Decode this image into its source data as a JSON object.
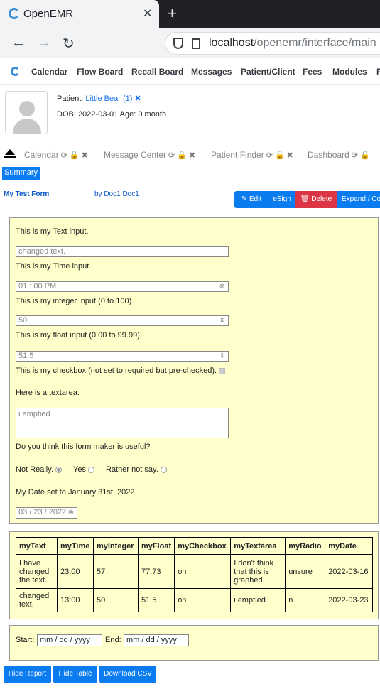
{
  "browser": {
    "tab_title": "OpenEMR",
    "tab_close": "✕",
    "new_tab": "+",
    "url_host": "localhost",
    "url_path": "/openemr/interface/main",
    "back": "←",
    "forward": "→",
    "reload": "↻"
  },
  "menu": {
    "items": [
      "Calendar",
      "Flow Board",
      "Recall Board",
      "Messages",
      "Patient/Client",
      "Fees",
      "Modules",
      "P"
    ]
  },
  "patient": {
    "label": "Patient:",
    "name": "Little Bear (1)",
    "remove_icon": "✖",
    "dob_line": "DOB: 2022-03-01 Age: 0 month"
  },
  "tabs": [
    {
      "label": "Calendar"
    },
    {
      "label": "Message Center"
    },
    {
      "label": "Patient Finder"
    },
    {
      "label": "Dashboard"
    }
  ],
  "tab_icons": {
    "reload": "⟳",
    "lock": "🔓",
    "close": "✖"
  },
  "summary_tab": "Summary",
  "form": {
    "title": "My Test Form",
    "by": "by Doc1 Doc1",
    "buttons": {
      "edit": "✎ Edit",
      "esign": "eSign",
      "delete": "🗑 Delete",
      "expand": "Expand / Co"
    }
  },
  "fields": {
    "text_label": "This is my Text input.",
    "text_value": "changed text.",
    "time_label": "This is my Time input.",
    "time_value": "01 : 00   PM",
    "int_label": "This is my integer input (0 to 100).",
    "int_value": "50",
    "float_label": "This is my float input (0.00 to 99.99).",
    "float_value": "51.5",
    "checkbox_label": "This is my checkbox (not set to required but pre-checked).",
    "textarea_label": "Here is a textarea:",
    "textarea_value": "i emptied",
    "radio_question": "Do you think this form maker is useful?",
    "radio_options": [
      "Not Really.",
      "Yes",
      "Rather not say."
    ],
    "radio_selected": "Not Really.",
    "date_label": "My Date set to January 31st, 2022",
    "date_value": "03 / 23 / 2022"
  },
  "table": {
    "headers": [
      "myText",
      "myTime",
      "myInteger",
      "myFloat",
      "myCheckbox",
      "myTextarea",
      "myRadio",
      "myDate"
    ],
    "rows": [
      [
        "I have changed the text.",
        "23:00",
        "57",
        "77.73",
        "on",
        "I don't think that this is graphed.",
        "unsure",
        "2022-03-16"
      ],
      [
        "changed text.",
        "13:00",
        "50",
        "51.5",
        "on",
        "i emptied",
        "n",
        "2022-03-23"
      ]
    ]
  },
  "filter": {
    "start_label": "Start:",
    "end_label": "End:",
    "start_placeholder": "mm / dd / yyyy",
    "end_placeholder": "mm / dd / yyyy"
  },
  "bottom_buttons": [
    "Hide Report",
    "Hide Table",
    "Download CSV"
  ],
  "colors": {
    "primary": "#0a7cf0",
    "danger": "#dc3545",
    "panel": "#ffffcc"
  }
}
